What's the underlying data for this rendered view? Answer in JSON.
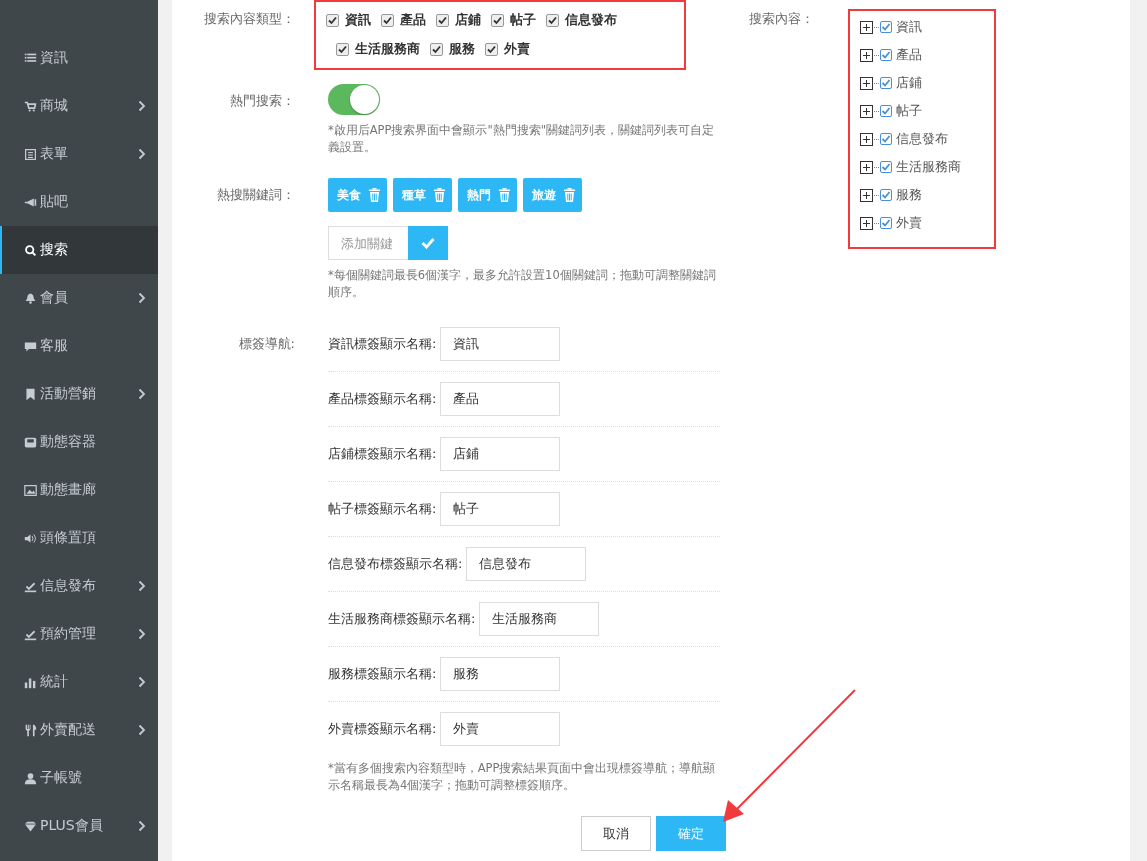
{
  "sidebar": {
    "items": [
      {
        "label": "資訊",
        "selected": false,
        "submenu": false
      },
      {
        "label": "商城",
        "selected": false,
        "submenu": true
      },
      {
        "label": "表單",
        "selected": false,
        "submenu": true
      },
      {
        "label": "貼吧",
        "selected": false,
        "submenu": false
      },
      {
        "label": "搜索",
        "selected": true,
        "submenu": false
      },
      {
        "label": "會員",
        "selected": false,
        "submenu": true
      },
      {
        "label": "客服",
        "selected": false,
        "submenu": false
      },
      {
        "label": "活動營銷",
        "selected": false,
        "submenu": true
      },
      {
        "label": "動態容器",
        "selected": false,
        "submenu": false
      },
      {
        "label": "動態畫廊",
        "selected": false,
        "submenu": false
      },
      {
        "label": "頭條置頂",
        "selected": false,
        "submenu": false
      },
      {
        "label": "信息發布",
        "selected": false,
        "submenu": true
      },
      {
        "label": "預約管理",
        "selected": false,
        "submenu": true
      },
      {
        "label": "統計",
        "selected": false,
        "submenu": true
      },
      {
        "label": "外賣配送",
        "selected": false,
        "submenu": true
      },
      {
        "label": "子帳號",
        "selected": false,
        "submenu": false
      },
      {
        "label": "PLUS會員",
        "selected": false,
        "submenu": true
      }
    ]
  },
  "search_types": {
    "label": "搜索內容類型：",
    "options": [
      {
        "label": "資訊",
        "checked": true
      },
      {
        "label": "產品",
        "checked": true
      },
      {
        "label": "店鋪",
        "checked": true
      },
      {
        "label": "帖子",
        "checked": true
      },
      {
        "label": "信息發布",
        "checked": true
      },
      {
        "label": "生活服務商",
        "checked": true
      },
      {
        "label": "服務",
        "checked": true
      },
      {
        "label": "外賣",
        "checked": true
      }
    ]
  },
  "hot_search": {
    "label": "熱門搜索：",
    "on": true,
    "note": "*啟用后APP搜索界面中會顯示\"熱門搜索\"關鍵詞列表，關鍵詞列表可自定義設置。"
  },
  "hot_keywords": {
    "label": "熱搜關鍵詞：",
    "tags": [
      "美食",
      "種草",
      "熱門",
      "旅遊"
    ],
    "add_field": {
      "placeholder": "添加關鍵"
    },
    "note": "*每個關鍵詞最長6個漢字，最多允許設置10個關鍵詞；拖動可調整關鍵詞順序。"
  },
  "tab_nav": {
    "label": "標簽導航:",
    "rows": [
      {
        "label": "資訊標簽顯示名稱:",
        "value": "資訊"
      },
      {
        "label": "產品標簽顯示名稱:",
        "value": "產品"
      },
      {
        "label": "店鋪標簽顯示名稱:",
        "value": "店鋪"
      },
      {
        "label": "帖子標簽顯示名稱:",
        "value": "帖子"
      },
      {
        "label": "信息發布標簽顯示名稱:",
        "value": "信息發布"
      },
      {
        "label": "生活服務商標簽顯示名稱:",
        "value": "生活服務商"
      },
      {
        "label": "服務標簽顯示名稱:",
        "value": "服務"
      },
      {
        "label": "外賣標簽顯示名稱:",
        "value": "外賣"
      }
    ],
    "note": "*當有多個搜索內容類型時，APP搜索結果頁面中會出現標簽導航；導航顯示名稱最長為4個漢字；拖動可調整標簽順序。"
  },
  "search_content": {
    "label": "搜索內容：",
    "tree": [
      {
        "label": "資訊",
        "checked": true,
        "expanded": false
      },
      {
        "label": "產品",
        "checked": true,
        "expanded": false
      },
      {
        "label": "店鋪",
        "checked": true,
        "expanded": false
      },
      {
        "label": "帖子",
        "checked": true,
        "expanded": false
      },
      {
        "label": "信息發布",
        "checked": true,
        "expanded": false
      },
      {
        "label": "生活服務商",
        "checked": true,
        "expanded": false
      },
      {
        "label": "服務",
        "checked": true,
        "expanded": false
      },
      {
        "label": "外賣",
        "checked": true,
        "expanded": false
      }
    ]
  },
  "buttons": {
    "cancel": "取消",
    "confirm": "確定"
  }
}
